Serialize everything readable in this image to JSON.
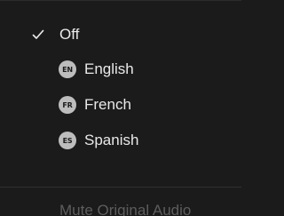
{
  "menu": {
    "items": [
      {
        "label": "Off",
        "selected": true
      },
      {
        "label": "English",
        "badge": "EN"
      },
      {
        "label": "French",
        "badge": "FR"
      },
      {
        "label": "Spanish",
        "badge": "ES"
      }
    ],
    "mute_label": "Mute Original Audio"
  },
  "colors": {
    "background": "#1b1b1b",
    "text": "#e9e9e9",
    "badge": "#bdbdbd",
    "disabled_text": "#5d5d5d"
  },
  "icons": {
    "selected": "checkmark-icon",
    "english": "en-badge-icon",
    "french": "fr-badge-icon",
    "spanish": "es-badge-icon"
  }
}
